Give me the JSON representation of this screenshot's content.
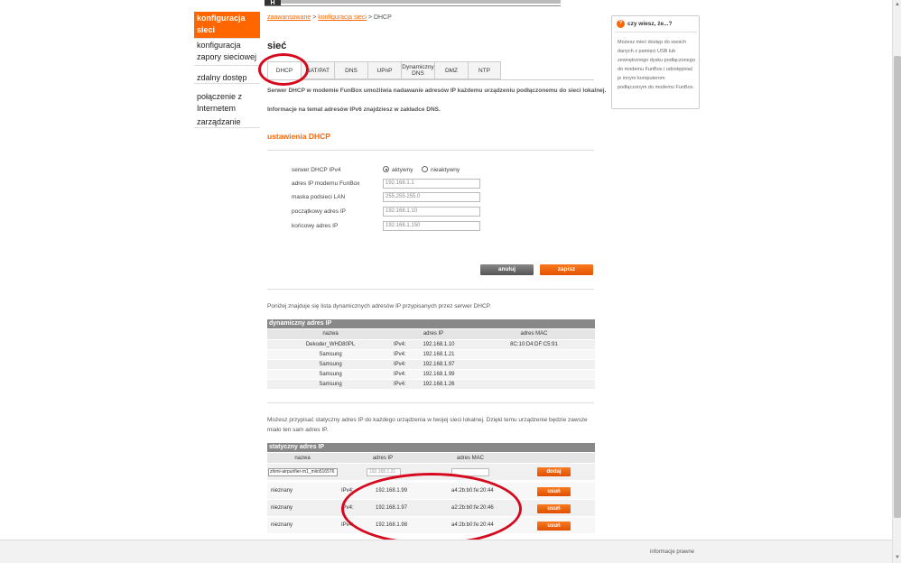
{
  "topbar": {
    "logo": "H"
  },
  "leftnav": {
    "items": [
      {
        "label": "konfiguracja sieci"
      },
      {
        "label": "konfiguracja zapory sieciowej"
      },
      {
        "label": "zdalny dostęp"
      },
      {
        "label": "połączenie z Internetem"
      },
      {
        "label": "zarządzanie"
      }
    ]
  },
  "breadcrumb": {
    "link1": "zaawansowane",
    "sep1": " > ",
    "link2": "konfiguracja sieci",
    "sep2": " > ",
    "current": "DHCP"
  },
  "page_title": "sieć",
  "tabs": [
    {
      "label": "DHCP"
    },
    {
      "label": "NAT/PAT"
    },
    {
      "label": "DNS"
    },
    {
      "label": "UPnP"
    },
    {
      "label": "Dynamiczny DNS"
    },
    {
      "label": "DMZ"
    },
    {
      "label": "NTP"
    }
  ],
  "info1": "Serwer DHCP w modemie FunBox umożliwia nadawanie adresów IP każdemu urządzeniu podłączonemu do sieci lokalnej.",
  "info2": "Informacje na temat adresów IPv6 znajdziesz w zakładce DNS.",
  "settings": {
    "title": "ustawienia DHCP",
    "server_label": "serwer DHCP IPv4",
    "active_label": "aktywny",
    "inactive_label": "nieaktywny",
    "active_selected": true,
    "fields": [
      {
        "label": "adres IP modemu FunBox",
        "value": "192.168.1.1"
      },
      {
        "label": "maska podsieci LAN",
        "value": "255.255.255.0"
      },
      {
        "label": "początkowy adres IP",
        "value": "192.168.1.10"
      },
      {
        "label": "końcowy adres IP",
        "value": "192.168.1.150"
      }
    ],
    "cancel_label": "anuluj",
    "save_label": "zapisz"
  },
  "dynamic": {
    "intro": "Poniżej znajduje się lista dynamicznych adresów IP przypisanych przez serwer DHCP.",
    "title": "dynamiczny adres IP",
    "col_name": "nazwa",
    "col_ip": "adres IP",
    "col_mac": "adres MAC",
    "rows": [
      {
        "name": "Dekoder_WHD80PL",
        "proto": "IPv4:",
        "ip": "192.168.1.10",
        "mac": "8C:10:D4:DF:C5:91"
      },
      {
        "name": "Samsung",
        "proto": "IPv4:",
        "ip": "192.168.1.21",
        "mac": ""
      },
      {
        "name": "Samsung",
        "proto": "IPv4:",
        "ip": "192.168.1.97",
        "mac": ""
      },
      {
        "name": "Samsung",
        "proto": "IPv4:",
        "ip": "192.168.1.99",
        "mac": ""
      },
      {
        "name": "Samsung",
        "proto": "IPv4:",
        "ip": "192.168.1.26",
        "mac": ""
      }
    ]
  },
  "static": {
    "intro": "Możesz przypisać statyczny adres IP do każdego urządzenia w twojej sieci lokalnej. Dzięki temu urządzenie będzie zawsze miało ten sam adres IP.",
    "title": "statyczny adres IP",
    "col_name": "nazwa",
    "col_ip": "adres IP",
    "col_mac": "adres MAC",
    "new_device_selected": "zhimi-airpurifier-m1_miio516576",
    "new_ip_placeholder": "192.168.1.21",
    "add_label": "dodaj",
    "rows": [
      {
        "name": "nieznany",
        "proto": "IPv4:",
        "ip": "192.168.1.99",
        "mac": "a4:2b:b0:fe:20:44",
        "remove_label": "usuń"
      },
      {
        "name": "nieznany",
        "proto": "IPv4:",
        "ip": "192.168.1.97",
        "mac": "a2:2b:b0:fe:20:46",
        "remove_label": "usuń"
      },
      {
        "name": "nieznany",
        "proto": "IPv4:",
        "ip": "192.168.1.98",
        "mac": "a4:2b:b0:fe:20:44",
        "remove_label": "usuń"
      }
    ]
  },
  "sidebox": {
    "title": "czy wiesz, że...?",
    "icon": "?",
    "body": "Możesz mieć dostęp do swoich danych z pamięci USB lub zewnętrznego dysku podłączonego do modemu FunBox i udostępniać je innym komputerom podłączonym do modemu FunBox."
  },
  "footer": {
    "legal": "informacje prawne"
  },
  "colors": {
    "accent": "#ff6600",
    "annotation": "#d60a1e"
  }
}
